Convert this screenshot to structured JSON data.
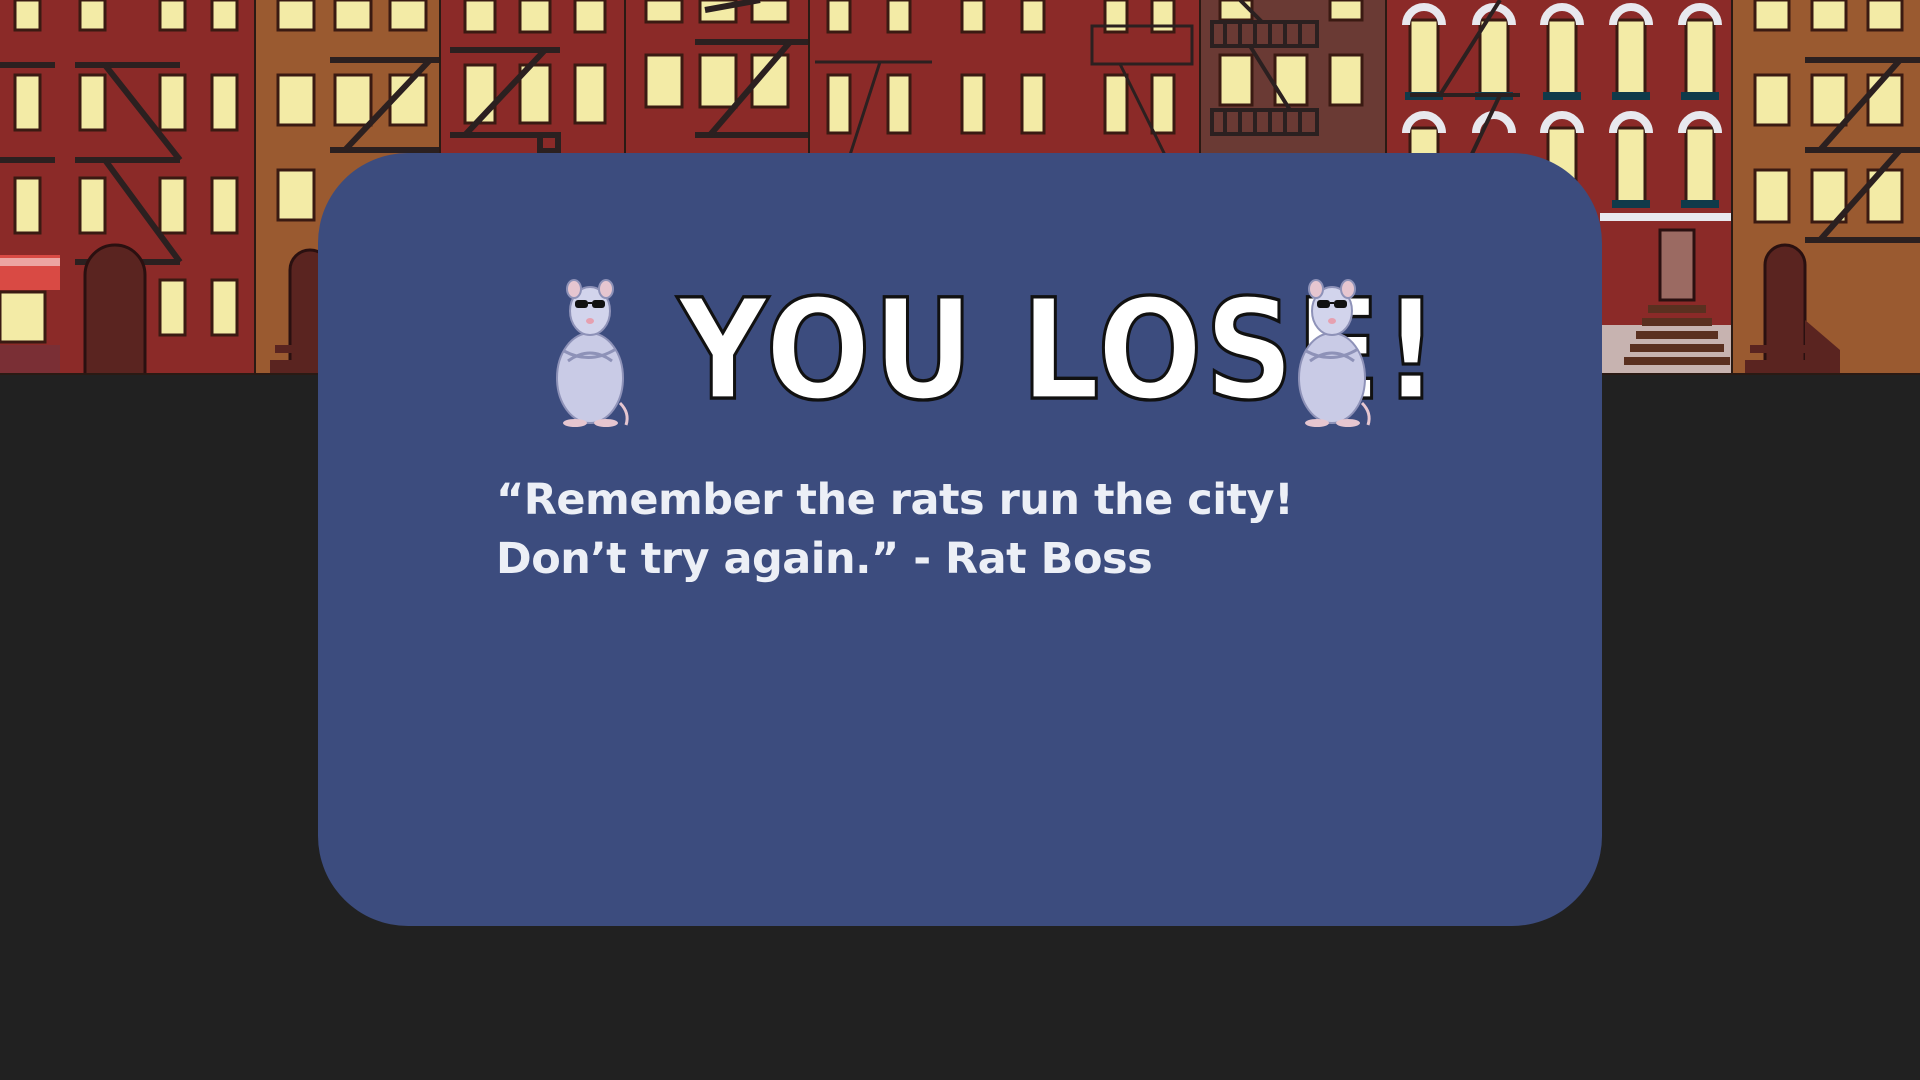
{
  "game": {
    "result_title": "YOU LOSE!",
    "quote": "“Remember the rats run the city! Don’t try again.” - Rat Boss"
  },
  "scene": {
    "background": "city-street-brownstones",
    "street_color": "#212121",
    "modal_color": "#3c4c7e",
    "window_color": "#f2e9a4"
  },
  "icons": {
    "left": "rat-with-sunglasses-icon",
    "right": "rat-with-sunglasses-icon"
  }
}
